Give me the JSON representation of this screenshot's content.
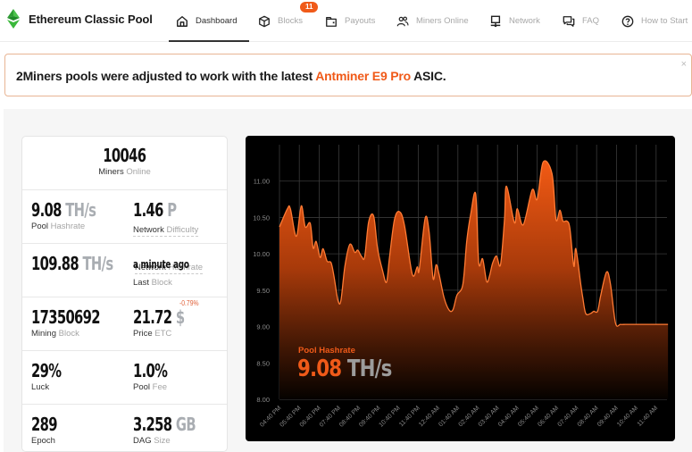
{
  "app": {
    "title": "Ethereum Classic Pool",
    "logo": "etc-diamond-logo",
    "colors": {
      "accent": "#f05a19",
      "logo_green": "#3ab83a",
      "chart_bg": "#000000"
    }
  },
  "nav": {
    "items": [
      {
        "label": "Dashboard",
        "icon": "home-icon",
        "active": true
      },
      {
        "label": "Blocks",
        "icon": "cube-icon",
        "badge": "11"
      },
      {
        "label": "Payouts",
        "icon": "wallet-icon"
      },
      {
        "label": "Miners Online",
        "icon": "users-icon"
      },
      {
        "label": "Network",
        "icon": "network-icon"
      },
      {
        "label": "FAQ",
        "icon": "chat-icon"
      },
      {
        "label": "How to Start",
        "icon": "help-circle-icon"
      }
    ]
  },
  "alert": {
    "prefix": "2Miners pools were adjusted to work with the latest ",
    "highlight": "Antminer E9 Pro",
    "suffix": " ASIC.",
    "close": "×"
  },
  "stats": {
    "miners_online": {
      "value": "10046",
      "label_a": "Miners",
      "label_b": " Online"
    },
    "pool_hashrate": {
      "value": "9.08",
      "unit": " TH/s",
      "label_a": "Pool",
      "label_b": " Hashrate"
    },
    "network_difficulty": {
      "value": "1.46",
      "unit": " P",
      "label_a": "Network",
      "label_b": " Difficulty"
    },
    "network_hashrate": {
      "value": "109.88",
      "unit": " TH/s",
      "label_a": "Network",
      "label_b": " Hashrate"
    },
    "last_block": {
      "value": "a minute ago",
      "label_a": "Last",
      "label_b": " Block"
    },
    "mining_block": {
      "value": "17350692",
      "label_a": "Mining",
      "label_b": " Block"
    },
    "price": {
      "value": "21.72",
      "unit": " $",
      "change": "-0.79%",
      "label_a": "Price",
      "label_b": " ETC"
    },
    "luck": {
      "value": "29%",
      "label_a": "Luck"
    },
    "pool_fee": {
      "value": "1.0%",
      "label_a": "Pool",
      "label_b": " Fee"
    },
    "epoch": {
      "value": "289",
      "label_a": "Epoch"
    },
    "dag_size": {
      "value": "3.258",
      "unit": " GB",
      "label_a": "DAG",
      "label_b": " Size"
    }
  },
  "chart_overlay": {
    "label": "Pool Hashrate",
    "value": "9.08",
    "unit": " TH/s"
  },
  "chart_data": {
    "type": "area",
    "title": "Pool Hashrate",
    "xlabel": "",
    "ylabel": "TH/s",
    "ylim": [
      8.0,
      11.5
    ],
    "yticks": [
      "8.00",
      "8.50",
      "9.00",
      "9.50",
      "10.00",
      "10.50",
      "11.00"
    ],
    "ytick_values": [
      8.0,
      8.5,
      9.0,
      9.5,
      10.0,
      10.5,
      11.0
    ],
    "xticks": [
      "04:40 PM",
      "05:40 PM",
      "06:40 PM",
      "07:40 PM",
      "08:40 PM",
      "09:40 PM",
      "10:40 PM",
      "11:40 PM",
      "12:40 AM",
      "01:40 AM",
      "02:40 AM",
      "03:40 AM",
      "04:40 AM",
      "05:40 AM",
      "06:40 AM",
      "07:40 AM",
      "08:40 AM",
      "09:40 AM",
      "10:40 AM",
      "11:40 AM"
    ],
    "grid": true,
    "x_hours_from_start": [
      0,
      0.4,
      0.55,
      0.85,
      1.1,
      1.3,
      1.55,
      1.7,
      1.85,
      2.05,
      2.2,
      2.4,
      2.6,
      2.75,
      2.95,
      3.1,
      3.3,
      3.55,
      3.8,
      3.95,
      4.15,
      4.3,
      4.5,
      4.75,
      4.95,
      5.2,
      5.4,
      5.55,
      5.8,
      6.05,
      6.3,
      6.7,
      6.95,
      7.05,
      7.35,
      7.55,
      7.75,
      7.9,
      8.05,
      8.3,
      8.55,
      8.75,
      8.95,
      9.25,
      9.45,
      9.65,
      9.9,
      10.05,
      10.25,
      10.45,
      10.6,
      10.75,
      10.95,
      11.15,
      11.35,
      11.45,
      11.85,
      12.0,
      12.3,
      12.75,
      13.0,
      13.3,
      13.75,
      13.95,
      14.15,
      14.3,
      14.5,
      14.65,
      14.85,
      14.95,
      15.2,
      15.3,
      15.45,
      15.7,
      15.85,
      16.05,
      16.2,
      16.5,
      16.7,
      16.95,
      17.2,
      17.45,
      17.7,
      17.95,
      18.15,
      18.35,
      18.6,
      18.95,
      19.15,
      19.4,
      19.6
    ],
    "values": [
      10.37,
      10.62,
      10.62,
      10.24,
      10.66,
      10.37,
      10.42,
      10.08,
      10.17,
      9.95,
      10.07,
      9.9,
      9.88,
      9.69,
      9.36,
      9.36,
      9.83,
      10.13,
      10.02,
      10.05,
      9.96,
      9.96,
      10.44,
      10.52,
      10.07,
      9.77,
      9.61,
      9.95,
      10.47,
      10.58,
      10.4,
      9.72,
      9.82,
      9.78,
      10.49,
      10.3,
      9.66,
      9.85,
      9.72,
      9.4,
      9.23,
      9.23,
      9.43,
      9.58,
      10.18,
      10.55,
      10.82,
      9.88,
      9.93,
      9.62,
      9.7,
      9.87,
      9.97,
      9.85,
      10.47,
      10.93,
      10.43,
      10.62,
      10.4,
      10.88,
      10.75,
      11.26,
      11.1,
      10.47,
      10.6,
      10.45,
      10.45,
      10.35,
      9.83,
      10.07,
      9.58,
      9.4,
      9.18,
      9.18,
      9.21,
      9.21,
      9.42,
      9.75,
      9.58,
      9.05,
      9.03,
      9.03,
      9.03,
      9.03,
      9.03,
      9.03,
      9.03,
      9.03,
      9.03,
      9.03,
      9.03
    ]
  }
}
